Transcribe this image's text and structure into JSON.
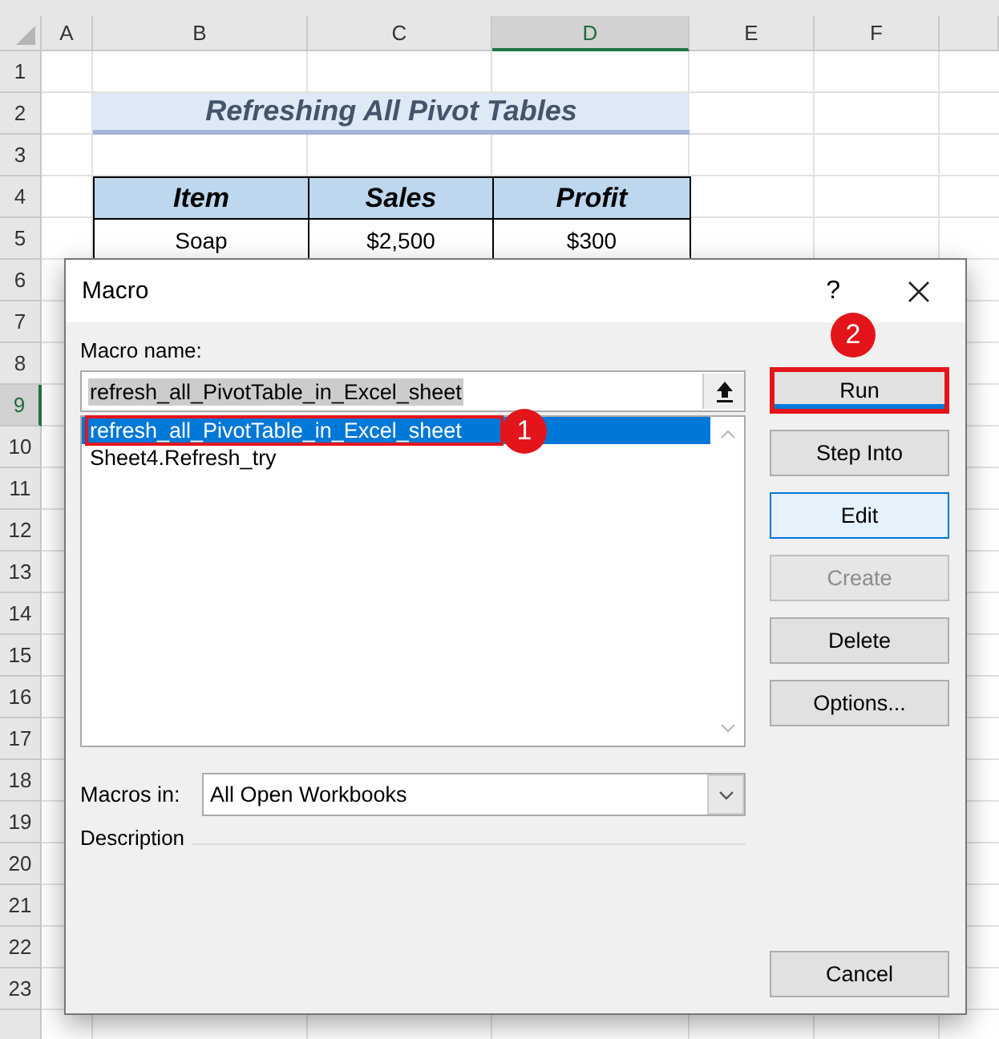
{
  "sheet": {
    "columns": [
      {
        "label": "A",
        "selected": false
      },
      {
        "label": "B",
        "selected": false
      },
      {
        "label": "C",
        "selected": false
      },
      {
        "label": "D",
        "selected": true
      },
      {
        "label": "E",
        "selected": false
      },
      {
        "label": "F",
        "selected": false
      }
    ],
    "rows": [
      {
        "label": "1",
        "selected": false
      },
      {
        "label": "2",
        "selected": false
      },
      {
        "label": "3",
        "selected": false
      },
      {
        "label": "4",
        "selected": false
      },
      {
        "label": "5",
        "selected": false
      },
      {
        "label": "6",
        "selected": false
      },
      {
        "label": "7",
        "selected": false
      },
      {
        "label": "8",
        "selected": false
      },
      {
        "label": "9",
        "selected": true
      },
      {
        "label": "10",
        "selected": false
      },
      {
        "label": "11",
        "selected": false
      },
      {
        "label": "12",
        "selected": false
      },
      {
        "label": "13",
        "selected": false
      },
      {
        "label": "14",
        "selected": false
      },
      {
        "label": "15",
        "selected": false
      },
      {
        "label": "16",
        "selected": false
      },
      {
        "label": "17",
        "selected": false
      },
      {
        "label": "18",
        "selected": false
      },
      {
        "label": "19",
        "selected": false
      },
      {
        "label": "20",
        "selected": false
      },
      {
        "label": "21",
        "selected": false
      },
      {
        "label": "22",
        "selected": false
      },
      {
        "label": "23",
        "selected": false
      }
    ],
    "title": "Refreshing All Pivot Tables",
    "table": {
      "headers": [
        "Item",
        "Sales",
        "Profit"
      ],
      "rows": [
        [
          "Soap",
          "$2,500",
          "$300"
        ]
      ]
    }
  },
  "dialog": {
    "title": "Macro",
    "help": "?",
    "macro_name_label": "Macro name:",
    "macro_name_value": "refresh_all_PivotTable_in_Excel_sheet",
    "macros": [
      {
        "name": "refresh_all_PivotTable_in_Excel_sheet",
        "selected": true,
        "highlighted": true,
        "callout": "1"
      },
      {
        "name": "Sheet4.Refresh_try",
        "selected": false,
        "highlighted": false
      }
    ],
    "buttons": [
      {
        "label": "Run",
        "kind": "default",
        "disabled": false,
        "highlighted": true,
        "callout": "2"
      },
      {
        "label": "Step Into",
        "kind": "normal",
        "disabled": false,
        "highlighted": false
      },
      {
        "label": "Edit",
        "kind": "focused",
        "disabled": false,
        "highlighted": false
      },
      {
        "label": "Create",
        "kind": "normal",
        "disabled": true,
        "highlighted": false
      },
      {
        "label": "Delete",
        "kind": "normal",
        "disabled": false,
        "highlighted": false
      },
      {
        "label": "Options...",
        "kind": "normal",
        "disabled": false,
        "highlighted": false
      }
    ],
    "macros_in_label": "Macros in:",
    "macros_in_value": "All Open Workbooks",
    "description_label": "Description",
    "cancel": "Cancel"
  }
}
